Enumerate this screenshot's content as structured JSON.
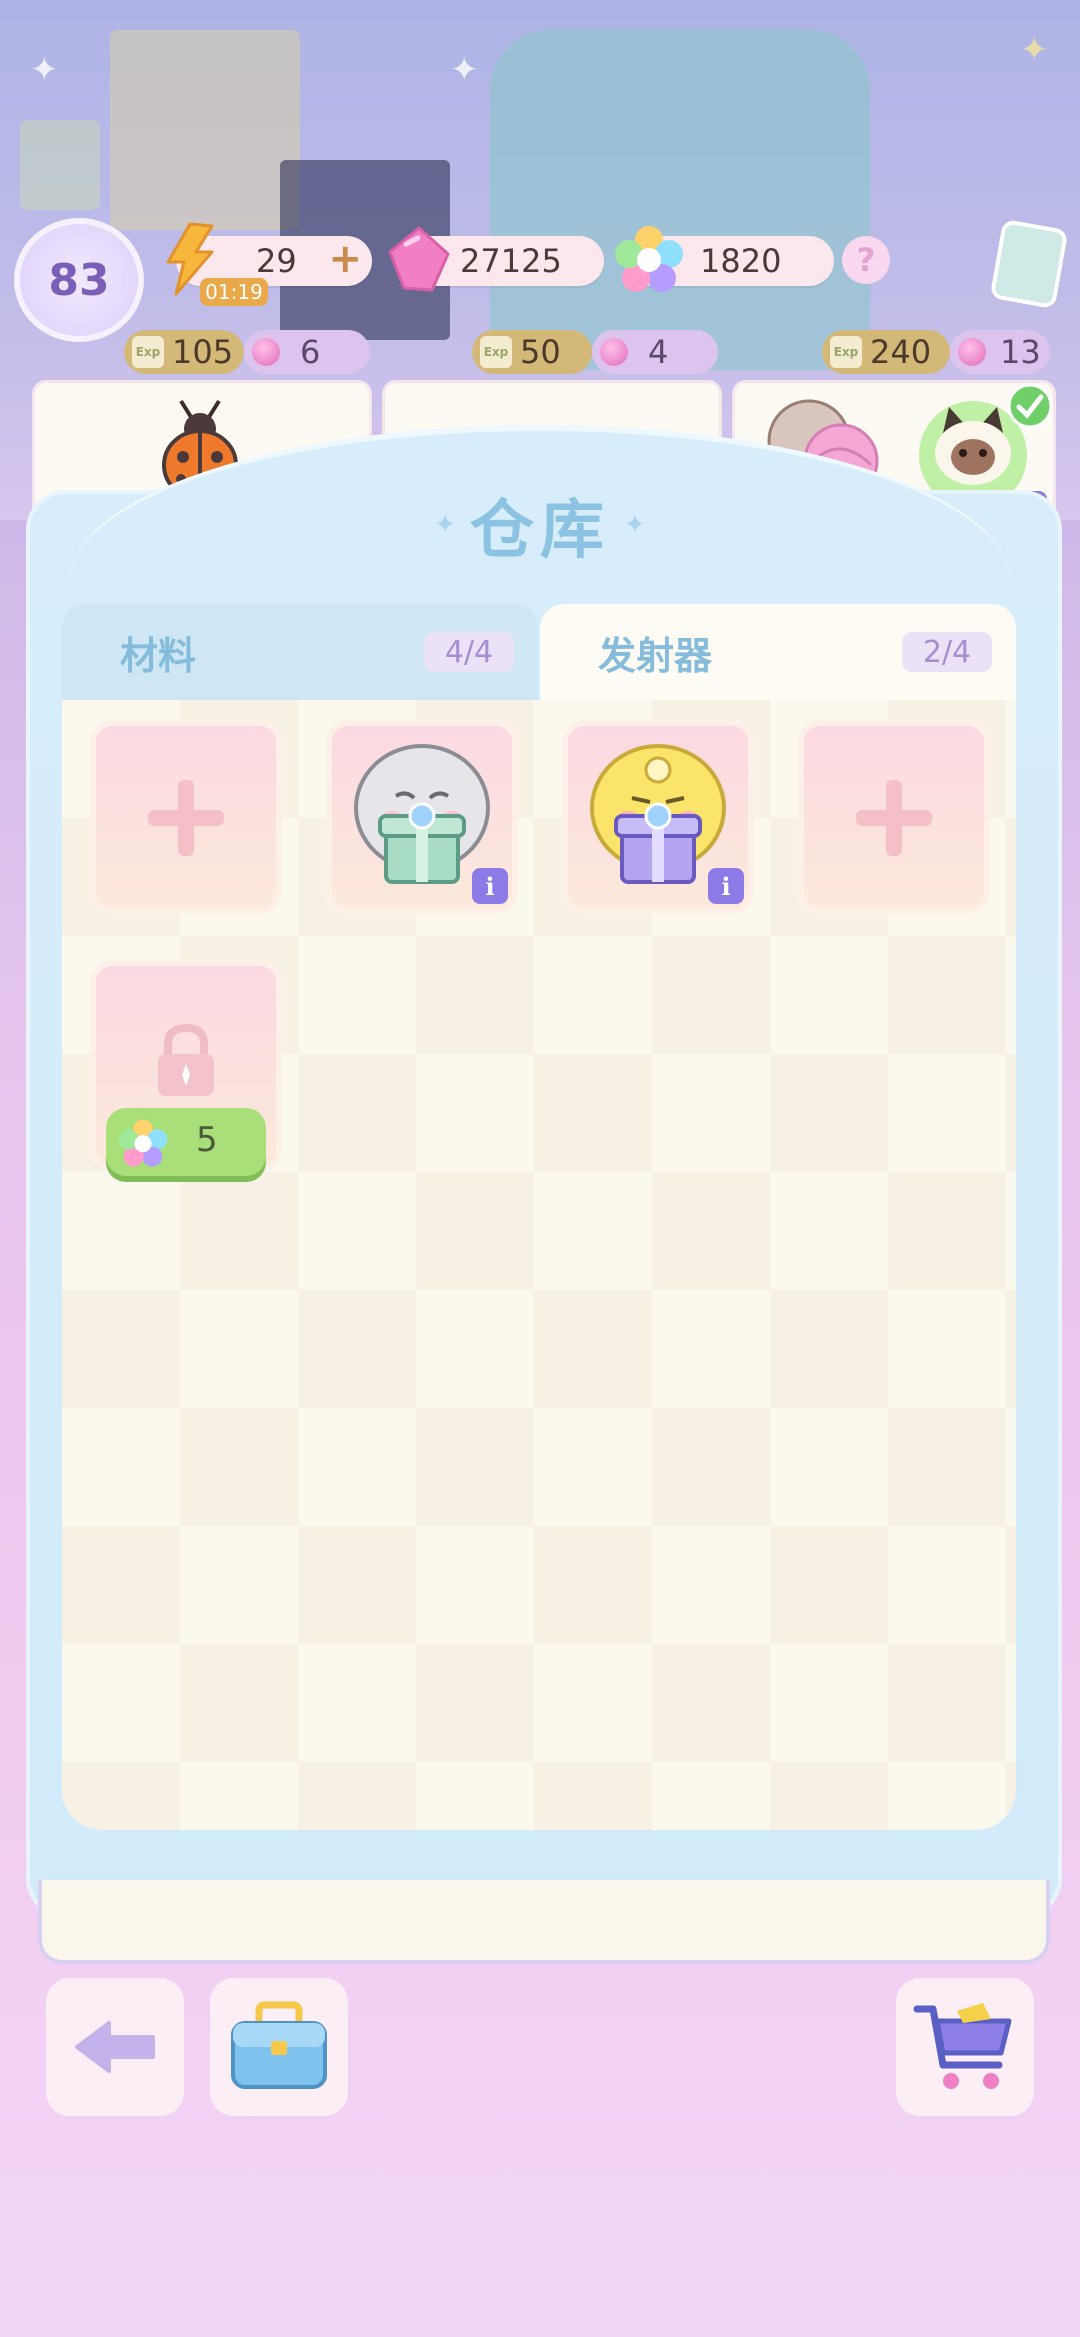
{
  "hud": {
    "level": "83",
    "energy": "29",
    "energy_plus": "+",
    "energy_timer": "01:19",
    "gems": "27125",
    "stars": "1820",
    "help": "?"
  },
  "orders": [
    {
      "exp": "105",
      "gems": "6"
    },
    {
      "exp": "50",
      "gems": "4"
    },
    {
      "exp": "240",
      "gems": "13"
    }
  ],
  "exp_badge_label": "Exp",
  "warehouse": {
    "title": "仓库",
    "tabs": [
      {
        "label": "材料",
        "count": "4/4"
      },
      {
        "label": "发射器",
        "count": "2/4"
      }
    ],
    "unlock_cost": "5"
  },
  "colors": {
    "panel": "#d7edfb",
    "tab_active": "#fdfbf3",
    "accent_purple": "#8c7be6",
    "unlock_green": "#a8df78"
  },
  "icons": [
    "lightning-icon",
    "pink-gem-icon",
    "rainbow-star-icon",
    "help-icon",
    "card-icon",
    "ladybug-icon",
    "yarn-icon",
    "cat-icon",
    "lock-icon",
    "back-arrow-icon",
    "toolbox-icon",
    "shopping-cart-icon"
  ]
}
